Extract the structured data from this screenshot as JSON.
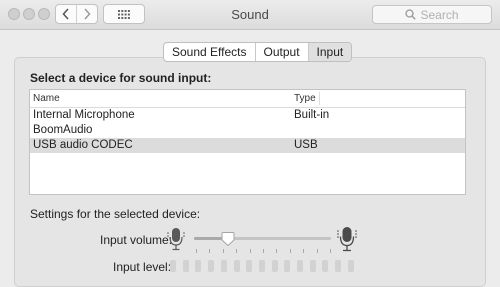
{
  "window": {
    "title": "Sound"
  },
  "search": {
    "placeholder": "Search"
  },
  "tabs": [
    {
      "label": "Sound Effects",
      "selected": false
    },
    {
      "label": "Output",
      "selected": false
    },
    {
      "label": "Input",
      "selected": true
    }
  ],
  "device_section": {
    "heading": "Select a device for sound input:",
    "columns": [
      "Name",
      "Type"
    ],
    "rows": [
      {
        "name": "Internal Microphone",
        "type": "Built-in",
        "selected": false
      },
      {
        "name": "BoomAudio",
        "type": "",
        "selected": false
      },
      {
        "name": "USB audio CODEC",
        "type": "USB",
        "selected": true
      }
    ]
  },
  "settings": {
    "heading": "Settings for the selected device:",
    "input_volume_label": "Input volume:",
    "input_volume_fraction": 0.25,
    "input_level_label": "Input level:",
    "input_level_segments": 15,
    "input_level_active": 0
  },
  "colors": {
    "window_bg": "#ececec",
    "selected_row": "#dcdcdc",
    "meter_inactive": "#d2d2d2"
  },
  "icons": [
    "back-chevron-icon",
    "forward-chevron-icon",
    "grid-icon",
    "search-icon",
    "microphone-low-icon",
    "microphone-high-icon"
  ]
}
